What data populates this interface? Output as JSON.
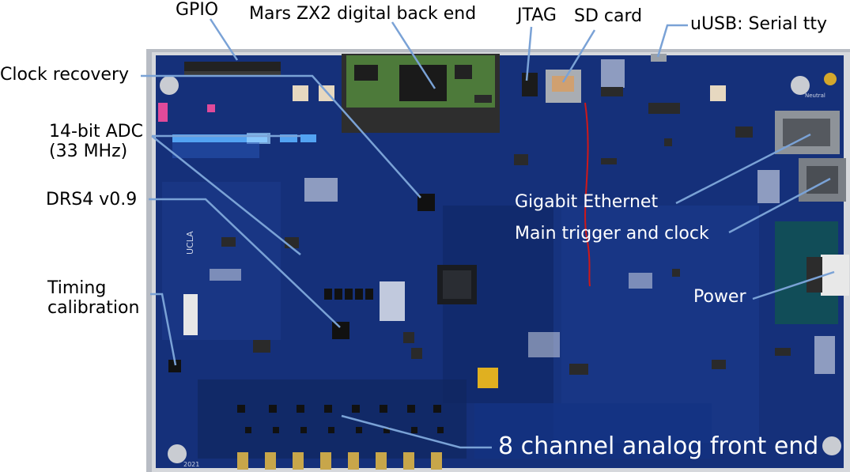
{
  "colors": {
    "board_blue": "#15307a",
    "board_blue_dark": "#0e2460",
    "pcb_green": "#4d7a3a",
    "leader_line": "#7aa2d6",
    "led_blue": "#5ab0ff"
  },
  "labels": {
    "gpio": "GPIO",
    "mars": "Mars ZX2 digital back end",
    "jtag": "JTAG",
    "sd": "SD card",
    "usb": "uUSB: Serial tty",
    "clock": "Clock recovery",
    "adc": "14-bit ADC\n(33 MHz)",
    "drs4": "DRS4 v0.9",
    "timing": "Timing\ncalibration",
    "gige": "Gigabit Ethernet",
    "trigger": "Main trigger and clock",
    "power": "Power",
    "frontend": "8 channel analog front end"
  },
  "board_text": {
    "ucla": "UCLA",
    "neutral": "Neutral",
    "year": "2021"
  }
}
